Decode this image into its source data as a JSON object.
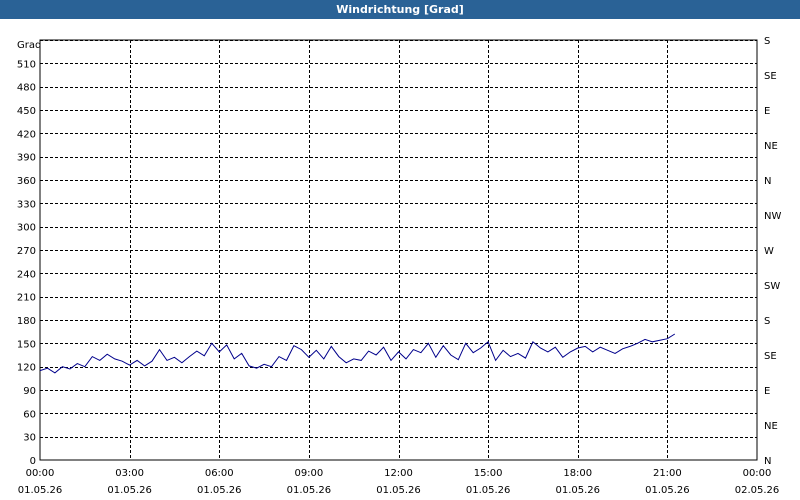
{
  "window": {
    "title": "Windrichtung [Grad]"
  },
  "chart_data": {
    "type": "line",
    "title": "Windrichtung [Grad]",
    "ylabel": "Grad",
    "ylim": [
      0,
      540
    ],
    "yticks": [
      0,
      30,
      60,
      90,
      120,
      150,
      180,
      210,
      240,
      270,
      300,
      330,
      360,
      390,
      420,
      450,
      480,
      510
    ],
    "xlim_hours": [
      0,
      24
    ],
    "xticks": [
      {
        "time": "00:00",
        "date": "01.05.26"
      },
      {
        "time": "03:00",
        "date": "01.05.26"
      },
      {
        "time": "06:00",
        "date": "01.05.26"
      },
      {
        "time": "09:00",
        "date": "01.05.26"
      },
      {
        "time": "12:00",
        "date": "01.05.26"
      },
      {
        "time": "15:00",
        "date": "01.05.26"
      },
      {
        "time": "18:00",
        "date": "01.05.26"
      },
      {
        "time": "21:00",
        "date": "01.05.26"
      },
      {
        "time": "00:00",
        "date": "02.05.26"
      }
    ],
    "right_axis_labels": [
      {
        "value": 0,
        "label": "N"
      },
      {
        "value": 45,
        "label": "NE"
      },
      {
        "value": 90,
        "label": "E"
      },
      {
        "value": 135,
        "label": "SE"
      },
      {
        "value": 180,
        "label": "S"
      },
      {
        "value": 225,
        "label": "SW"
      },
      {
        "value": 270,
        "label": "W"
      },
      {
        "value": 315,
        "label": "NW"
      },
      {
        "value": 360,
        "label": "N"
      },
      {
        "value": 405,
        "label": "NE"
      },
      {
        "value": 450,
        "label": "E"
      },
      {
        "value": 495,
        "label": "SE"
      },
      {
        "value": 540,
        "label": "S"
      }
    ],
    "grid": true,
    "series": [
      {
        "color": "#00008b",
        "x": [
          0.0,
          0.25,
          0.5,
          0.75,
          1.0,
          1.25,
          1.5,
          1.75,
          2.0,
          2.25,
          2.5,
          2.75,
          3.0,
          3.25,
          3.5,
          3.75,
          4.0,
          4.25,
          4.5,
          4.75,
          5.0,
          5.25,
          5.5,
          5.75,
          6.0,
          6.25,
          6.5,
          6.75,
          7.0,
          7.25,
          7.5,
          7.75,
          8.0,
          8.25,
          8.5,
          8.75,
          9.0,
          9.25,
          9.5,
          9.75,
          10.0,
          10.25,
          10.5,
          10.75,
          11.0,
          11.25,
          11.5,
          11.75,
          12.0,
          12.25,
          12.5,
          12.75,
          13.0,
          13.25,
          13.5,
          13.75,
          14.0,
          14.25,
          14.5,
          14.75,
          15.0,
          15.25,
          15.5,
          15.75,
          16.0,
          16.25,
          16.5,
          16.75,
          17.0,
          17.25,
          17.5,
          17.75,
          18.0,
          18.25,
          18.5,
          18.75,
          19.0,
          19.25,
          19.5,
          19.75,
          20.0,
          20.25,
          20.5,
          20.75,
          21.0,
          21.25
        ],
        "y": [
          115,
          118,
          112,
          120,
          117,
          124,
          120,
          133,
          128,
          136,
          130,
          127,
          122,
          128,
          121,
          127,
          142,
          128,
          132,
          125,
          133,
          140,
          134,
          150,
          139,
          148,
          130,
          137,
          121,
          118,
          123,
          120,
          133,
          128,
          147,
          142,
          132,
          141,
          130,
          146,
          133,
          125,
          130,
          128,
          140,
          135,
          145,
          128,
          139,
          130,
          142,
          138,
          150,
          132,
          147,
          135,
          129,
          150,
          138,
          144,
          152,
          128,
          141,
          133,
          137,
          131,
          152,
          144,
          139,
          145,
          132,
          139,
          144,
          146,
          139,
          145,
          141,
          137,
          143,
          146,
          150,
          155,
          152,
          154,
          156,
          162
        ]
      }
    ]
  }
}
